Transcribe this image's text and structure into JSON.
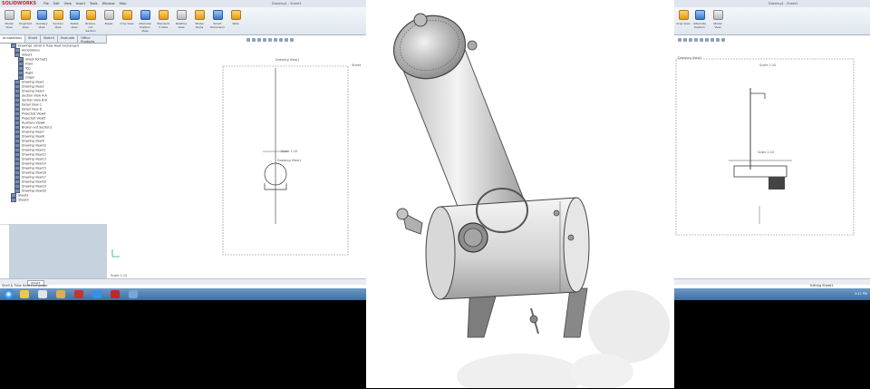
{
  "app": {
    "brand": "SOLIDWORKS",
    "menus": [
      "File",
      "Edit",
      "View",
      "Insert",
      "Tools",
      "Window",
      "Help"
    ],
    "doc_title": "Drawing1 - Sheet1",
    "doc_title_right": "Drawing1 - Sheet1"
  },
  "ribbon": {
    "buttons": [
      "Model View",
      "Projected View",
      "Auxiliary View",
      "Section View",
      "Detail View",
      "Broken-out Section",
      "Break",
      "Crop View",
      "Alternate Position View",
      "Standard 3 View",
      "Relative View",
      "Model Items",
      "Smart Dimension",
      "Note"
    ]
  },
  "right_ribbon": {
    "buttons": [
      "Crop View",
      "Alternate Position",
      "Model View"
    ]
  },
  "feature_tree": {
    "tabs": [
      "Annotations",
      "Sheet",
      "Sketch",
      "Evaluate",
      "Office Products"
    ],
    "root": "Drawing1 (Shell & Tube Heat Exchanger)",
    "items": [
      "Annotations",
      "Sheet1",
      "Sheet Format1",
      "Front",
      "Top",
      "Right",
      "Origin",
      "Drawing View1",
      "Drawing View2",
      "Drawing View3",
      "Section View A-A",
      "Section View B-B",
      "Detail View C",
      "Detail View D",
      "Projected View4",
      "Projected View5",
      "Auxiliary View6",
      "Broken-out Section1",
      "Drawing View7",
      "Drawing View8",
      "Drawing View9",
      "Drawing View10",
      "Drawing View11",
      "Drawing View12",
      "Drawing View13",
      "Drawing View14",
      "Drawing View15",
      "Drawing View16",
      "Drawing View17",
      "Drawing View18",
      "Drawing View19",
      "Drawing View20",
      "Sheet2",
      "Sheet3"
    ]
  },
  "sheet": {
    "view_label": "Drawing View1",
    "scale_label": "Scale 1:10",
    "right_view_label": "Drawing View2",
    "right_scale_label": "Scale 1:10",
    "corner_label": "Sheet"
  },
  "statusbar": {
    "sheet_tab": "Sheet1",
    "left_text": "Shell & Tube Heat Exchanger",
    "right_text": "Editing Sheet1"
  },
  "taskbar": {
    "clock": "3:42 PM"
  },
  "colors": {
    "title_bar": "#dfe6ef",
    "taskbar": "#3b6fa3",
    "brand_red": "#c1272d"
  }
}
